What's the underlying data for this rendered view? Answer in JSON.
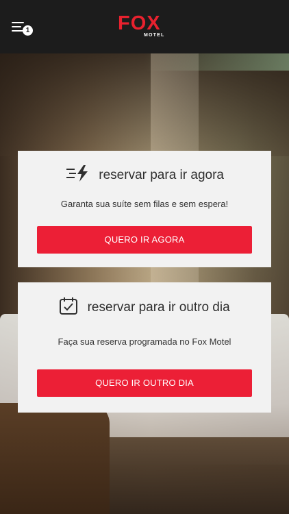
{
  "header": {
    "menu_badge": "1",
    "logo_text": "FOX",
    "logo_subtext": "MOTEL"
  },
  "cards": [
    {
      "title": "reservar para ir agora",
      "subtitle": "Garanta sua suíte sem filas e sem espera!",
      "button_label": "QUERO IR AGORA",
      "icon": "lightning-speed-icon"
    },
    {
      "title": "reservar para ir outro dia",
      "subtitle": "Faça sua reserva programada no Fox Motel",
      "button_label": "QUERO IR OUTRO DIA",
      "icon": "calendar-check-icon"
    }
  ],
  "colors": {
    "accent": "#ec1f36",
    "brand": "#e8212e",
    "topbar": "#1c1c1c",
    "card": "#f2f2f2"
  }
}
